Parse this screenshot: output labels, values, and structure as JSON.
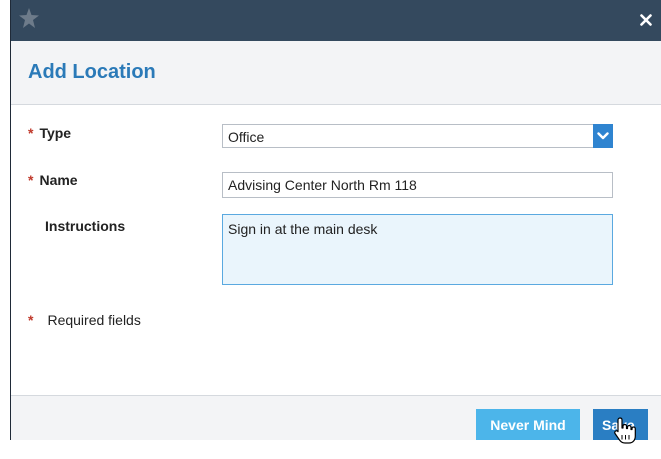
{
  "dialog": {
    "title": "Add Location"
  },
  "form": {
    "type": {
      "label": "Type",
      "value": "Office",
      "required": true
    },
    "name": {
      "label": "Name",
      "value": "Advising Center North Rm 118",
      "required": true
    },
    "instructions": {
      "label": "Instructions",
      "value": "Sign in at the main desk"
    },
    "required_note": "Required fields",
    "required_marker": "*"
  },
  "footer": {
    "never_mind_label": "Never Mind",
    "save_label": "Save"
  },
  "icons": {
    "logo": "star-logo-icon",
    "close": "close-icon",
    "dropdown": "chevron-down-icon",
    "cursor": "hand-pointer-cursor-icon"
  },
  "colors": {
    "titlebar": "#34495e",
    "title_text": "#2b7ab8",
    "required_star": "#c0392b",
    "never_mind_button": "#4cb5ea",
    "save_button": "#2a7ec3",
    "dropdown_chevron": "#2f84d0",
    "textarea_focus_border": "#5aa9e0"
  }
}
